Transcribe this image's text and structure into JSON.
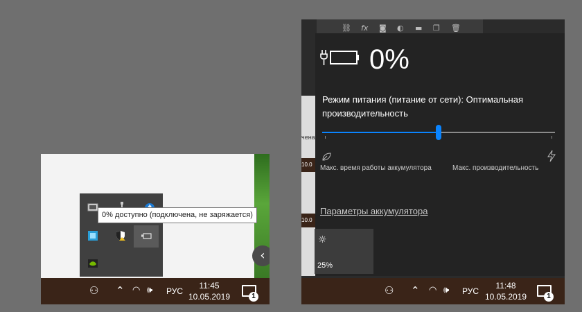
{
  "colors": {
    "accent": "#0a84ff",
    "taskbar": "#3a2418",
    "flyout_bg": "#232323"
  },
  "left": {
    "tooltip": "0% доступно (подключена, не заряжается)",
    "taskbar": {
      "lang": "РУС",
      "time": "11:45",
      "date": "10.05.2019",
      "notifications": "1"
    }
  },
  "right": {
    "battery_percent": "0%",
    "mode_label": "Режим питания (питание от сети): Оптимальная производительность",
    "slider_level": 0.5,
    "left_caption": "Макс. время работы аккумулятора",
    "right_caption": "Макс. производительность",
    "settings_link": "Параметры аккумулятора",
    "brightness": "25%",
    "taskbar": {
      "lang": "РУС",
      "time": "11:48",
      "date": "10.05.2019",
      "notifications": "1"
    },
    "side_fragments": {
      "a": "чена",
      "b": "10.0",
      "c": "10.0"
    }
  }
}
